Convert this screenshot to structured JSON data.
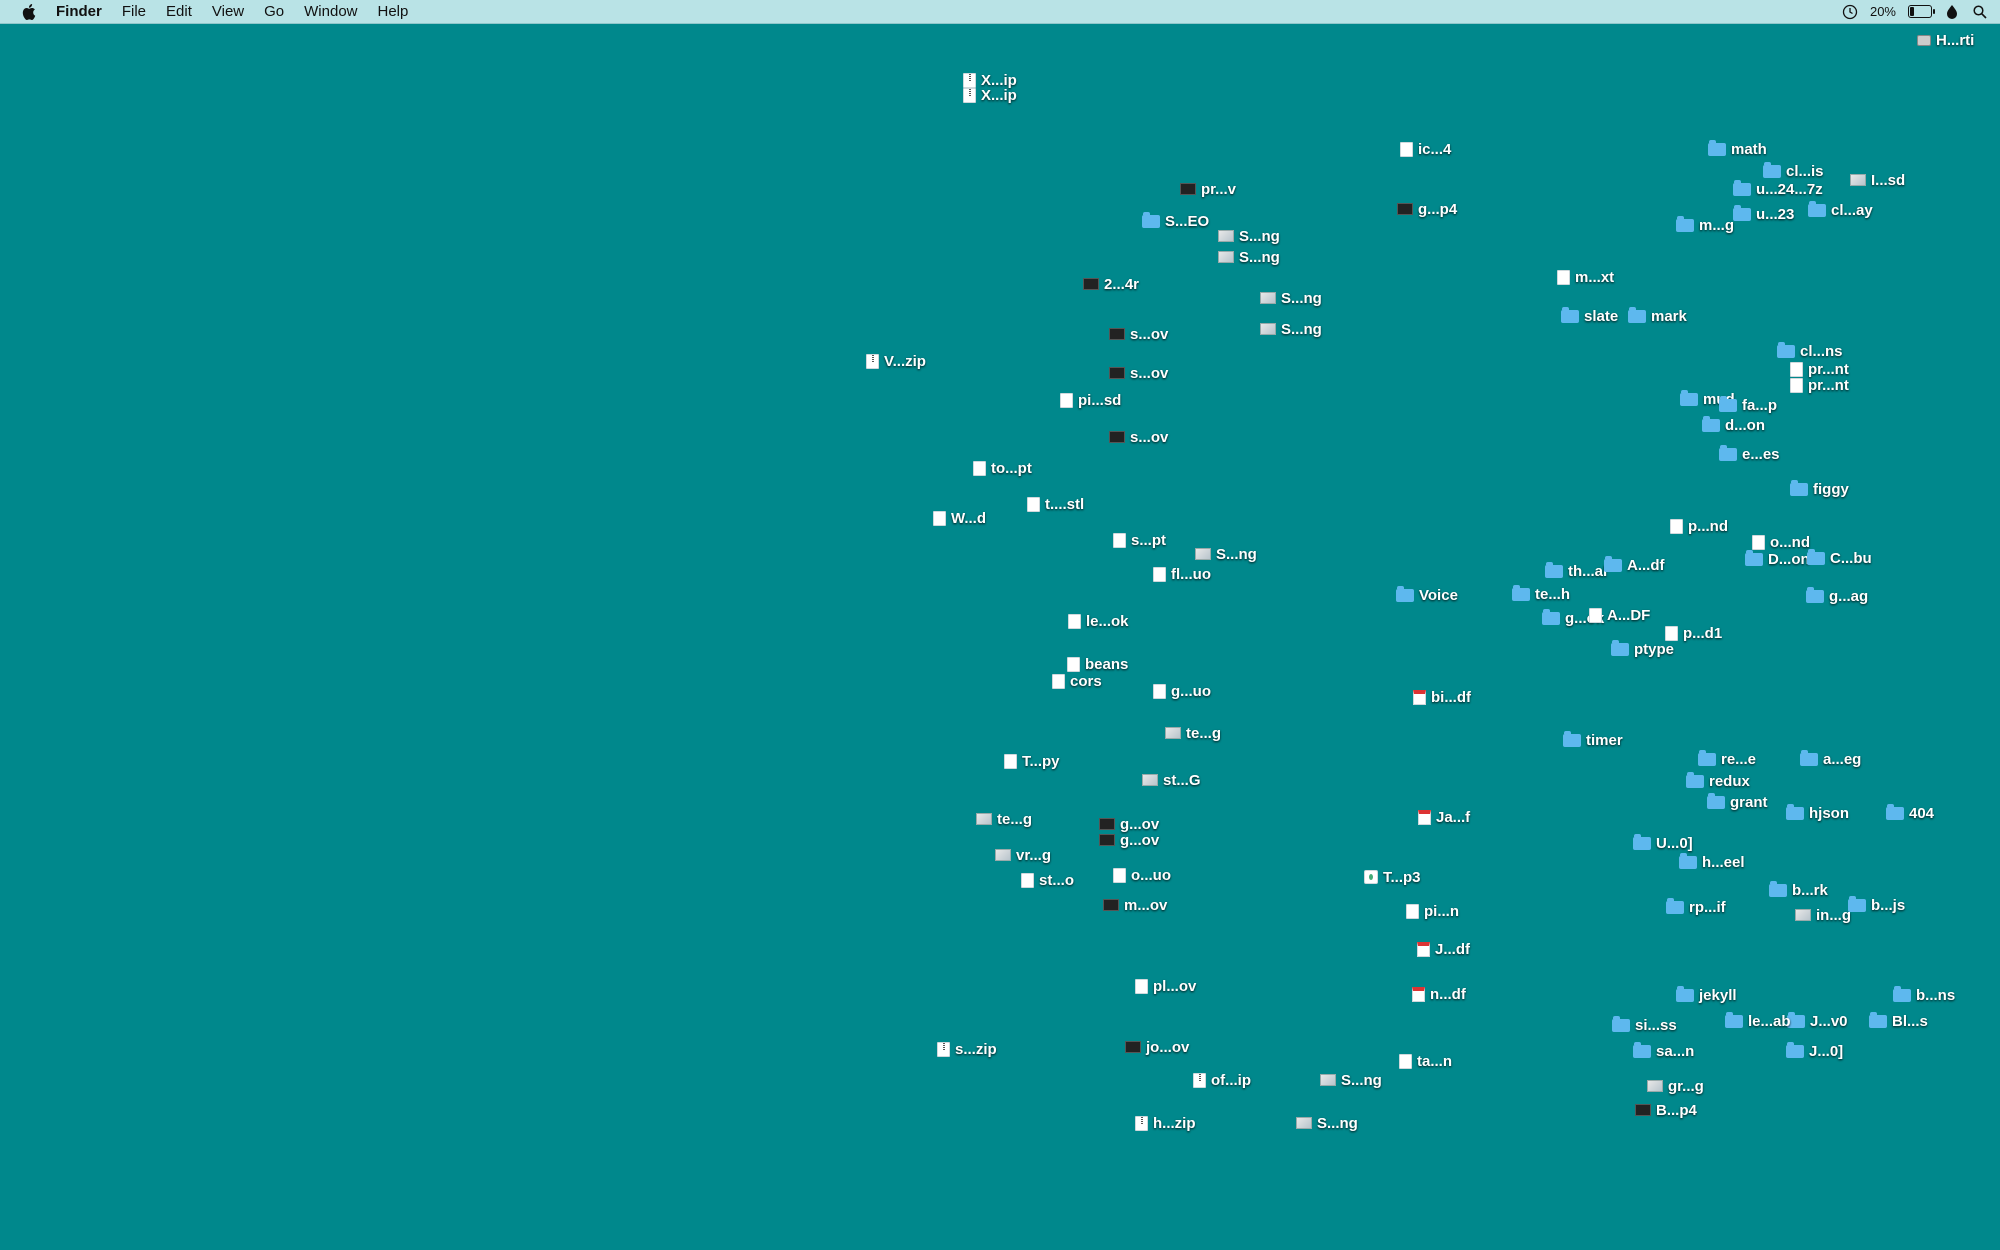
{
  "menubar": {
    "apple_icon": "apple-logo-icon",
    "app_name": "Finder",
    "menus": [
      "File",
      "Edit",
      "View",
      "Go",
      "Window",
      "Help"
    ],
    "battery_percent": "20%",
    "battery_level": 0.2
  },
  "desktop": {
    "background_color": "#00888c",
    "icons": [
      {
        "label": "H...rti",
        "type": "disk"
      },
      {
        "label": "X...ip",
        "type": "zip"
      },
      {
        "label": "X...ip",
        "type": "zip"
      },
      {
        "label": "ic...4",
        "type": "doc"
      },
      {
        "label": "math",
        "type": "folder"
      },
      {
        "label": "cl...is",
        "type": "folder"
      },
      {
        "label": "I...sd",
        "type": "image"
      },
      {
        "label": "u...24...7z",
        "type": "folder"
      },
      {
        "label": "pr...v",
        "type": "video"
      },
      {
        "label": "g...p4",
        "type": "video"
      },
      {
        "label": "u...23",
        "type": "folder"
      },
      {
        "label": "cl...ay",
        "type": "folder"
      },
      {
        "label": "S...EO",
        "type": "folder"
      },
      {
        "label": "S...ng",
        "type": "image"
      },
      {
        "label": "m...g",
        "type": "folder"
      },
      {
        "label": "S...ng",
        "type": "image"
      },
      {
        "label": "m...xt",
        "type": "doc"
      },
      {
        "label": "2...4r",
        "type": "video"
      },
      {
        "label": "S...ng",
        "type": "image"
      },
      {
        "label": "slate",
        "type": "folder"
      },
      {
        "label": "mark",
        "type": "folder"
      },
      {
        "label": "S...ng",
        "type": "image"
      },
      {
        "label": "V...zip",
        "type": "zip"
      },
      {
        "label": "s...ov",
        "type": "video"
      },
      {
        "label": "s...ov",
        "type": "video"
      },
      {
        "label": "cl...ns",
        "type": "folder"
      },
      {
        "label": "pr...nt",
        "type": "doc"
      },
      {
        "label": "pr...nt",
        "type": "doc"
      },
      {
        "label": "pi...sd",
        "type": "doc"
      },
      {
        "label": "mud",
        "type": "folder"
      },
      {
        "label": "fa...p",
        "type": "folder"
      },
      {
        "label": "s...ov",
        "type": "video"
      },
      {
        "label": "d...on",
        "type": "folder"
      },
      {
        "label": "e...es",
        "type": "folder"
      },
      {
        "label": "to...pt",
        "type": "doc"
      },
      {
        "label": "t....stl",
        "type": "doc"
      },
      {
        "label": "figgy",
        "type": "folder"
      },
      {
        "label": "W...d",
        "type": "doc"
      },
      {
        "label": "S...ng",
        "type": "image"
      },
      {
        "label": "p...nd",
        "type": "doc"
      },
      {
        "label": "o...nd",
        "type": "doc"
      },
      {
        "label": "s...pt",
        "type": "doc"
      },
      {
        "label": "D...on",
        "type": "folder"
      },
      {
        "label": "C...bu",
        "type": "folder"
      },
      {
        "label": "fl...uo",
        "type": "doc"
      },
      {
        "label": "th...al",
        "type": "folder"
      },
      {
        "label": "A...df",
        "type": "folder"
      },
      {
        "label": "g...ag",
        "type": "folder"
      },
      {
        "label": "Voice",
        "type": "folder"
      },
      {
        "label": "te...h",
        "type": "folder"
      },
      {
        "label": "le...ok",
        "type": "doc"
      },
      {
        "label": "g...ok",
        "type": "folder"
      },
      {
        "label": "A...DF",
        "type": "doc"
      },
      {
        "label": "p...d1",
        "type": "doc"
      },
      {
        "label": "beans",
        "type": "doc"
      },
      {
        "label": "cors",
        "type": "doc"
      },
      {
        "label": "ptype",
        "type": "folder"
      },
      {
        "label": "g...uo",
        "type": "doc"
      },
      {
        "label": "bi...df",
        "type": "pdf"
      },
      {
        "label": "te...g",
        "type": "image"
      },
      {
        "label": "timer",
        "type": "folder"
      },
      {
        "label": "T...py",
        "type": "doc"
      },
      {
        "label": "re...e",
        "type": "folder"
      },
      {
        "label": "a...eg",
        "type": "folder"
      },
      {
        "label": "st...G",
        "type": "image"
      },
      {
        "label": "te...g",
        "type": "image"
      },
      {
        "label": "redux",
        "type": "folder"
      },
      {
        "label": "grant",
        "type": "folder"
      },
      {
        "label": "hjson",
        "type": "folder"
      },
      {
        "label": "404",
        "type": "folder"
      },
      {
        "label": "g...ov",
        "type": "video"
      },
      {
        "label": "g...ov",
        "type": "video"
      },
      {
        "label": "Ja...f",
        "type": "pdf"
      },
      {
        "label": "U...0]",
        "type": "folder"
      },
      {
        "label": "vr...g",
        "type": "image"
      },
      {
        "label": "o...uo",
        "type": "doc"
      },
      {
        "label": "T...p3",
        "type": "audio"
      },
      {
        "label": "h...eel",
        "type": "folder"
      },
      {
        "label": "b...rk",
        "type": "folder"
      },
      {
        "label": "st...o",
        "type": "doc"
      },
      {
        "label": "m...ov",
        "type": "video"
      },
      {
        "label": "pi...n",
        "type": "doc"
      },
      {
        "label": "in...g",
        "type": "image"
      },
      {
        "label": "rp...if",
        "type": "folder"
      },
      {
        "label": "b...js",
        "type": "folder"
      },
      {
        "label": "J...df",
        "type": "pdf"
      },
      {
        "label": "pl...ov",
        "type": "doc"
      },
      {
        "label": "n...df",
        "type": "pdf"
      },
      {
        "label": "jekyll",
        "type": "folder"
      },
      {
        "label": "J...v0",
        "type": "folder"
      },
      {
        "label": "Bl...s",
        "type": "folder"
      },
      {
        "label": "si...ss",
        "type": "folder"
      },
      {
        "label": "le...ab",
        "type": "folder"
      },
      {
        "label": "b...ns",
        "type": "folder"
      },
      {
        "label": "s...zip",
        "type": "zip"
      },
      {
        "label": "jo...ov",
        "type": "video"
      },
      {
        "label": "ta...n",
        "type": "doc"
      },
      {
        "label": "sa...n",
        "type": "folder"
      },
      {
        "label": "J...0]",
        "type": "folder"
      },
      {
        "label": "of...ip",
        "type": "zip"
      },
      {
        "label": "gr...g",
        "type": "image"
      },
      {
        "label": "S...ng",
        "type": "image"
      },
      {
        "label": "B...p4",
        "type": "video"
      },
      {
        "label": "h...zip",
        "type": "zip"
      },
      {
        "label": "S...ng",
        "type": "image"
      }
    ]
  }
}
